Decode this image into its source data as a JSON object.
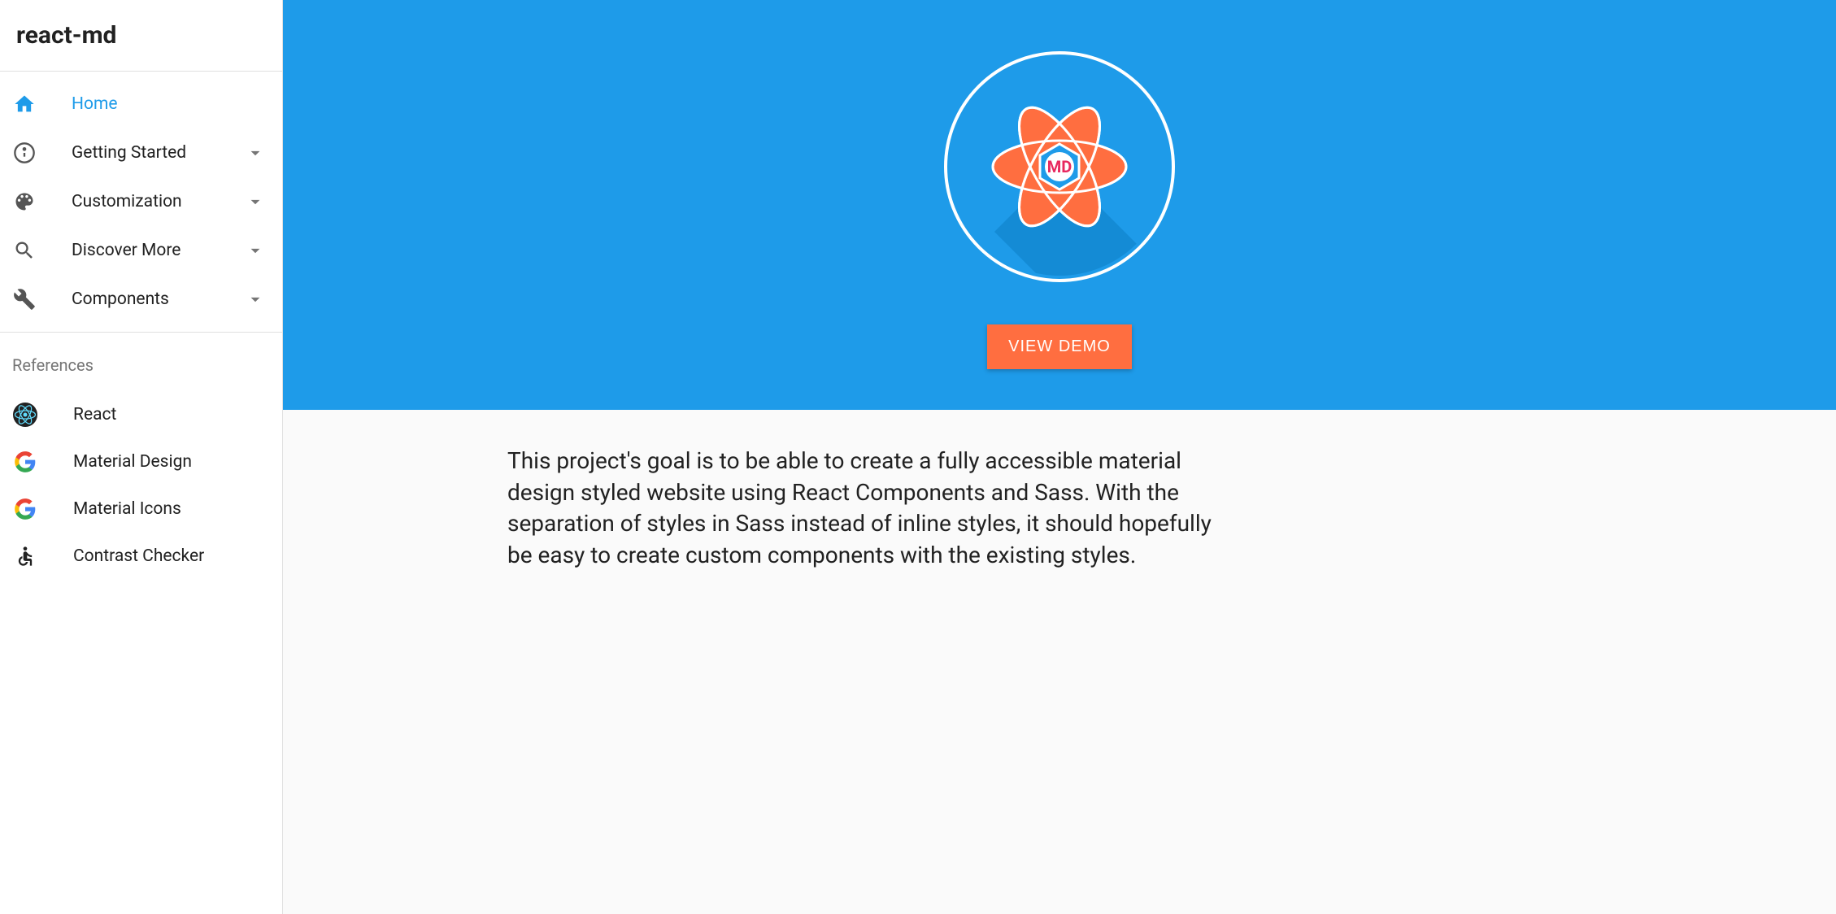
{
  "sidebar": {
    "title": "react-md",
    "nav": [
      {
        "label": "Home",
        "icon": "home",
        "active": true,
        "expandable": false
      },
      {
        "label": "Getting Started",
        "icon": "info",
        "active": false,
        "expandable": true
      },
      {
        "label": "Customization",
        "icon": "palette",
        "active": false,
        "expandable": true
      },
      {
        "label": "Discover More",
        "icon": "search",
        "active": false,
        "expandable": true
      },
      {
        "label": "Components",
        "icon": "wrench",
        "active": false,
        "expandable": true
      }
    ],
    "refs_header": "References",
    "refs": [
      {
        "label": "React",
        "icon": "react"
      },
      {
        "label": "Material Design",
        "icon": "google"
      },
      {
        "label": "Material Icons",
        "icon": "google"
      },
      {
        "label": "Contrast Checker",
        "icon": "accessibility"
      }
    ]
  },
  "hero": {
    "button_label": "VIEW DEMO",
    "logo_text": "MD"
  },
  "content": {
    "description": "This project's goal is to be able to create a fully accessible material design styled website using React Components and Sass. With the separation of styles in Sass instead of inline styles, it should hopefully be easy to create custom components with the existing styles."
  },
  "colors": {
    "primary": "#1e9be9",
    "accent": "#ff6e40"
  }
}
